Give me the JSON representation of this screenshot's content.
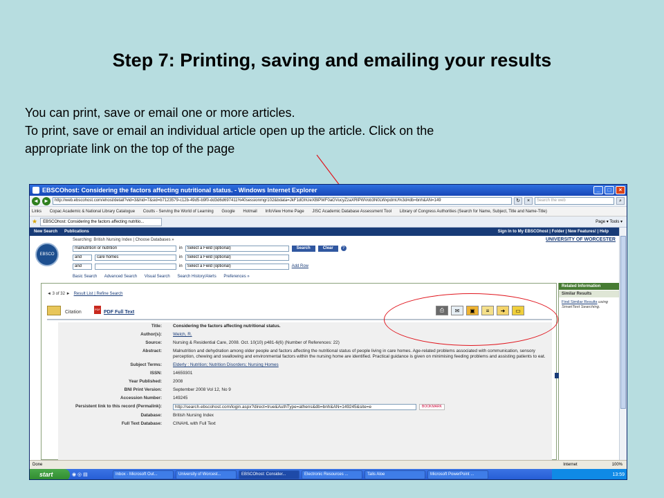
{
  "slide": {
    "title": "Step 7: Printing, saving and emailing your results",
    "body": [
      "You can print, save or email one or more articles.",
      "To print, save or email an individual article open up the article. Click on the",
      "appropriate link on the top of the page"
    ]
  },
  "browser": {
    "window_title": "EBSCOhost: Considering the factors affecting nutritional status. - Windows Internet Explorer",
    "url": "http://web.ebscohost.com/ehost/detail?vid=3&hid=7&sid=b7123579-c12b-49d5-b9f0-dd3d6d697411%40sessionmgr102&bdata=JkF1dGhUeXBlPWF0aGVucyZzaXRlPWVob3N0LWxpdmU%3d#db=bnh&AN=149",
    "search_placeholder": "Search the web",
    "links_bar": [
      "Links",
      "Copac Academic & National Library Catalogue",
      "Coutts - Serving the World of Learning",
      "Google",
      "Hotmail",
      "InfoView Home Page",
      "JISC Academic Database Assessment Tool",
      "Library of Congress Authorities (Search for Name, Subject, Title and Name-Title)"
    ],
    "tab_label": "EBSCOhost: Considering the factors affecting nutritio...",
    "tools_label": "Page ▾  Tools ▾",
    "status_left": "Done",
    "status_zone": "Internet",
    "status_zoom": "100%"
  },
  "ebsco": {
    "nav_left": [
      "New Search",
      "Publications"
    ],
    "nav_right": "Sign In to My EBSCOhost  |  Folder  |  New Features!  |  Help",
    "university": "UNIVERSITY OF WORCESTER",
    "logo_text": "EBSCO",
    "searching": "Searching: British Nursing Index   |   Choose Databases »",
    "rows": [
      {
        "op": "",
        "term": "malnutrition or nutrition",
        "field": "Select a Field (optional)"
      },
      {
        "op": "and",
        "term": "care homes",
        "field": "Select a Field (optional)"
      },
      {
        "op": "and",
        "term": "",
        "field": "Select a Field (optional)"
      }
    ],
    "in_label": "in",
    "search_button": "Search",
    "clear_button": "Clear",
    "add_row": "Add Row",
    "search_links": [
      "Basic Search",
      "Advanced Search",
      "Visual Search",
      "Search History/Alerts",
      "Preferences »"
    ],
    "result_nav": "◄ 3 of 32 ►",
    "result_links": "Result List | Refine Search",
    "citation_label": "Citation",
    "pdf_label": "PDF Full Text",
    "record": [
      {
        "label": "Title:",
        "value": "Considering the factors affecting nutritional status."
      },
      {
        "label": "Author(s):",
        "value": "Welch, R."
      },
      {
        "label": "Source:",
        "value": "Nursing & Residential Care, 2008. Oct. 10(10) p481-6(6) (Number of References: 22)"
      },
      {
        "label": "Abstract:",
        "value": "Malnutrition and dehydration among older people and factors affecting the nutritional status of people living in care homes. Age-related problems associated with communication, sensory perception, chewing and swallowing and environmental factors within the nursing home are identified. Practical guidance is given on minimising feeding problems and assisting patients to eat."
      },
      {
        "label": "Subject Terms:",
        "value": "Elderly : Nutrition; Nutrition Disorders; Nursing Homes"
      },
      {
        "label": "ISSN:",
        "value": "14659301"
      },
      {
        "label": "Year Published:",
        "value": "2008"
      },
      {
        "label": "BNI Print Version:",
        "value": "September 2008 Vol 12, No 9"
      },
      {
        "label": "Accession Number:",
        "value": "149245"
      },
      {
        "label": "Persistent link to this record (Permalink):",
        "value": "http://search.ebscohost.com/login.aspx?direct=true&AuthType=athens&db=bnh&AN=149245&site=e"
      },
      {
        "label": "Database:",
        "value": "British Nursing Index"
      },
      {
        "label": "Full Text Database:",
        "value": "CINAHL with Full Text"
      }
    ],
    "bookmark_label": "BOOKMARK",
    "sidebar": {
      "header": "Related Information",
      "subheader": "Similar Results",
      "link": "Find Similar Results",
      "text": "using SmartText Searching."
    }
  },
  "taskbar": {
    "start": "start",
    "tasks": [
      "Inbox - Microsoft Out...",
      "University of Worcest...",
      "EBSCOhost: Consider...",
      "Electronic Resources ...",
      "Talis Aloe",
      "Microsoft PowerPoint ..."
    ],
    "clock": "13:59"
  },
  "colors": {
    "slide_bg": "#b7dde0",
    "annotation": "#e0141c",
    "ebsco_nav": "#183b77"
  }
}
